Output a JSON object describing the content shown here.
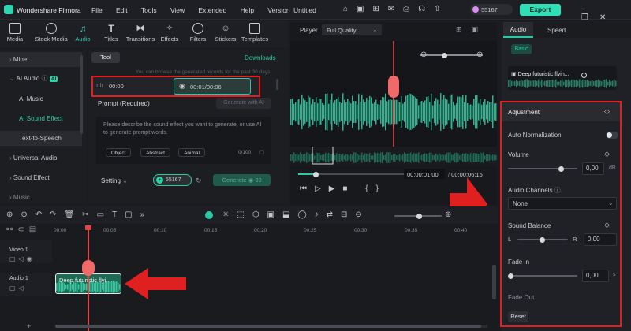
{
  "titlebar": {
    "app": "Wondershare Filmora",
    "menu": [
      "File",
      "Edit",
      "Tools",
      "View",
      "Extended",
      "Help",
      "Version"
    ],
    "project": "Untitled",
    "credits": "55167",
    "export": "Export"
  },
  "tools": [
    "Media",
    "Stock Media",
    "Audio",
    "Titles",
    "Transitions",
    "Effects",
    "Filters",
    "Stickers",
    "Templates"
  ],
  "sidebar": {
    "items": [
      "Mine",
      "AI Audio",
      "AI Music",
      "AI Sound Effect",
      "Text-to-Speech",
      "Universal Audio",
      "Sound Effect",
      "Music"
    ],
    "ai_badge": "AI"
  },
  "content": {
    "tab_tool": "Tool",
    "tab_downloads": "Downloads",
    "hint": "You can browse the generated records for the past 30 days.",
    "rec1_time": "00:00",
    "rec2_time": "00:01/00:06",
    "prompt_label": "Prompt (Required)",
    "gen_prompt": "Generate with AI",
    "placeholder": "Please describe the sound effect you want to generate, or use AI to generate prompt words.",
    "chips": [
      "Object",
      "Abstract",
      "Animal"
    ],
    "counter": "0/100",
    "setting": "Setting",
    "credits": "55167",
    "generate": "Generate",
    "gen_cost": "30"
  },
  "player": {
    "label": "Player",
    "quality": "Full Quality",
    "current": "00:00:01:00",
    "total": "00:00:06:15"
  },
  "right": {
    "tab_audio": "Audio",
    "tab_speed": "Speed",
    "basic": "Basic",
    "clip_name": "Deep futuristic flyin...",
    "adjustment": "Adjustment",
    "auto_norm": "Auto Normalization",
    "volume": "Volume",
    "volume_val": "0,00",
    "volume_unit": "dB",
    "channels": "Audio Channels",
    "channels_val": "None",
    "balance": "Sound Balance",
    "bal_l": "L",
    "bal_r": "R",
    "balance_val": "0,00",
    "fade_in": "Fade In",
    "fade_in_val": "0,00",
    "fade_in_unit": "s",
    "fade_out": "Fade Out",
    "reset": "Reset"
  },
  "timeline": {
    "ruler": [
      "00:00",
      "00:05",
      "00:10",
      "00:15",
      "00:20",
      "00:25",
      "00:30",
      "00:35",
      "00:40"
    ],
    "video_track": "Video 1",
    "audio_track": "Audio 1",
    "clip_label": "Deep futuristic flyi..."
  },
  "colors": {
    "accent": "#2dc7a3",
    "highlight": "#e02020",
    "waveform": "#36b08f"
  }
}
